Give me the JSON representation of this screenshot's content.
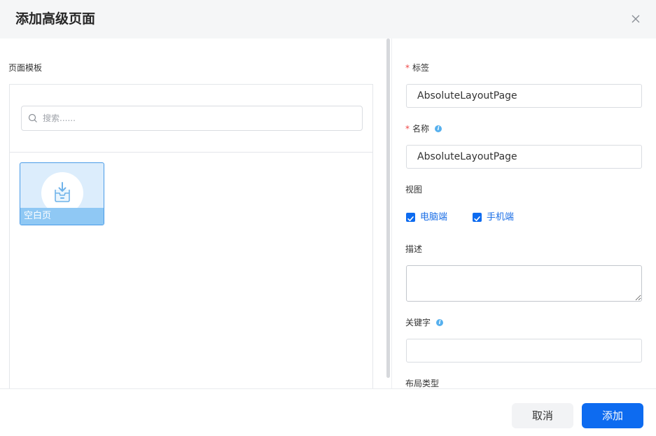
{
  "dialog": {
    "title": "添加高级页面"
  },
  "templates": {
    "label": "页面模板",
    "search_placeholder": "搜索......",
    "items": [
      {
        "label": "空白页"
      }
    ]
  },
  "form": {
    "tag": {
      "label": "标签",
      "required": true,
      "value": "AbsoluteLayoutPage"
    },
    "name": {
      "label": "名称",
      "required": true,
      "value": "AbsoluteLayoutPage"
    },
    "view": {
      "label": "视图",
      "options": [
        {
          "label": "电脑端",
          "checked": true
        },
        {
          "label": "手机端",
          "checked": true
        }
      ]
    },
    "description": {
      "label": "描述",
      "value": ""
    },
    "keywords": {
      "label": "关键字",
      "value": ""
    },
    "layout_type": {
      "label": "布局类型"
    }
  },
  "footer": {
    "cancel_label": "取消",
    "add_label": "添加"
  },
  "icons": {
    "close": "close-icon",
    "search": "search-icon",
    "info": "info-icon",
    "template": "inbox-download-icon",
    "check": "checkmark-icon"
  },
  "colors": {
    "primary": "#0d6bf0",
    "required": "#f04646",
    "info": "#56b0ee",
    "card_selected_border": "#4a9be8"
  }
}
